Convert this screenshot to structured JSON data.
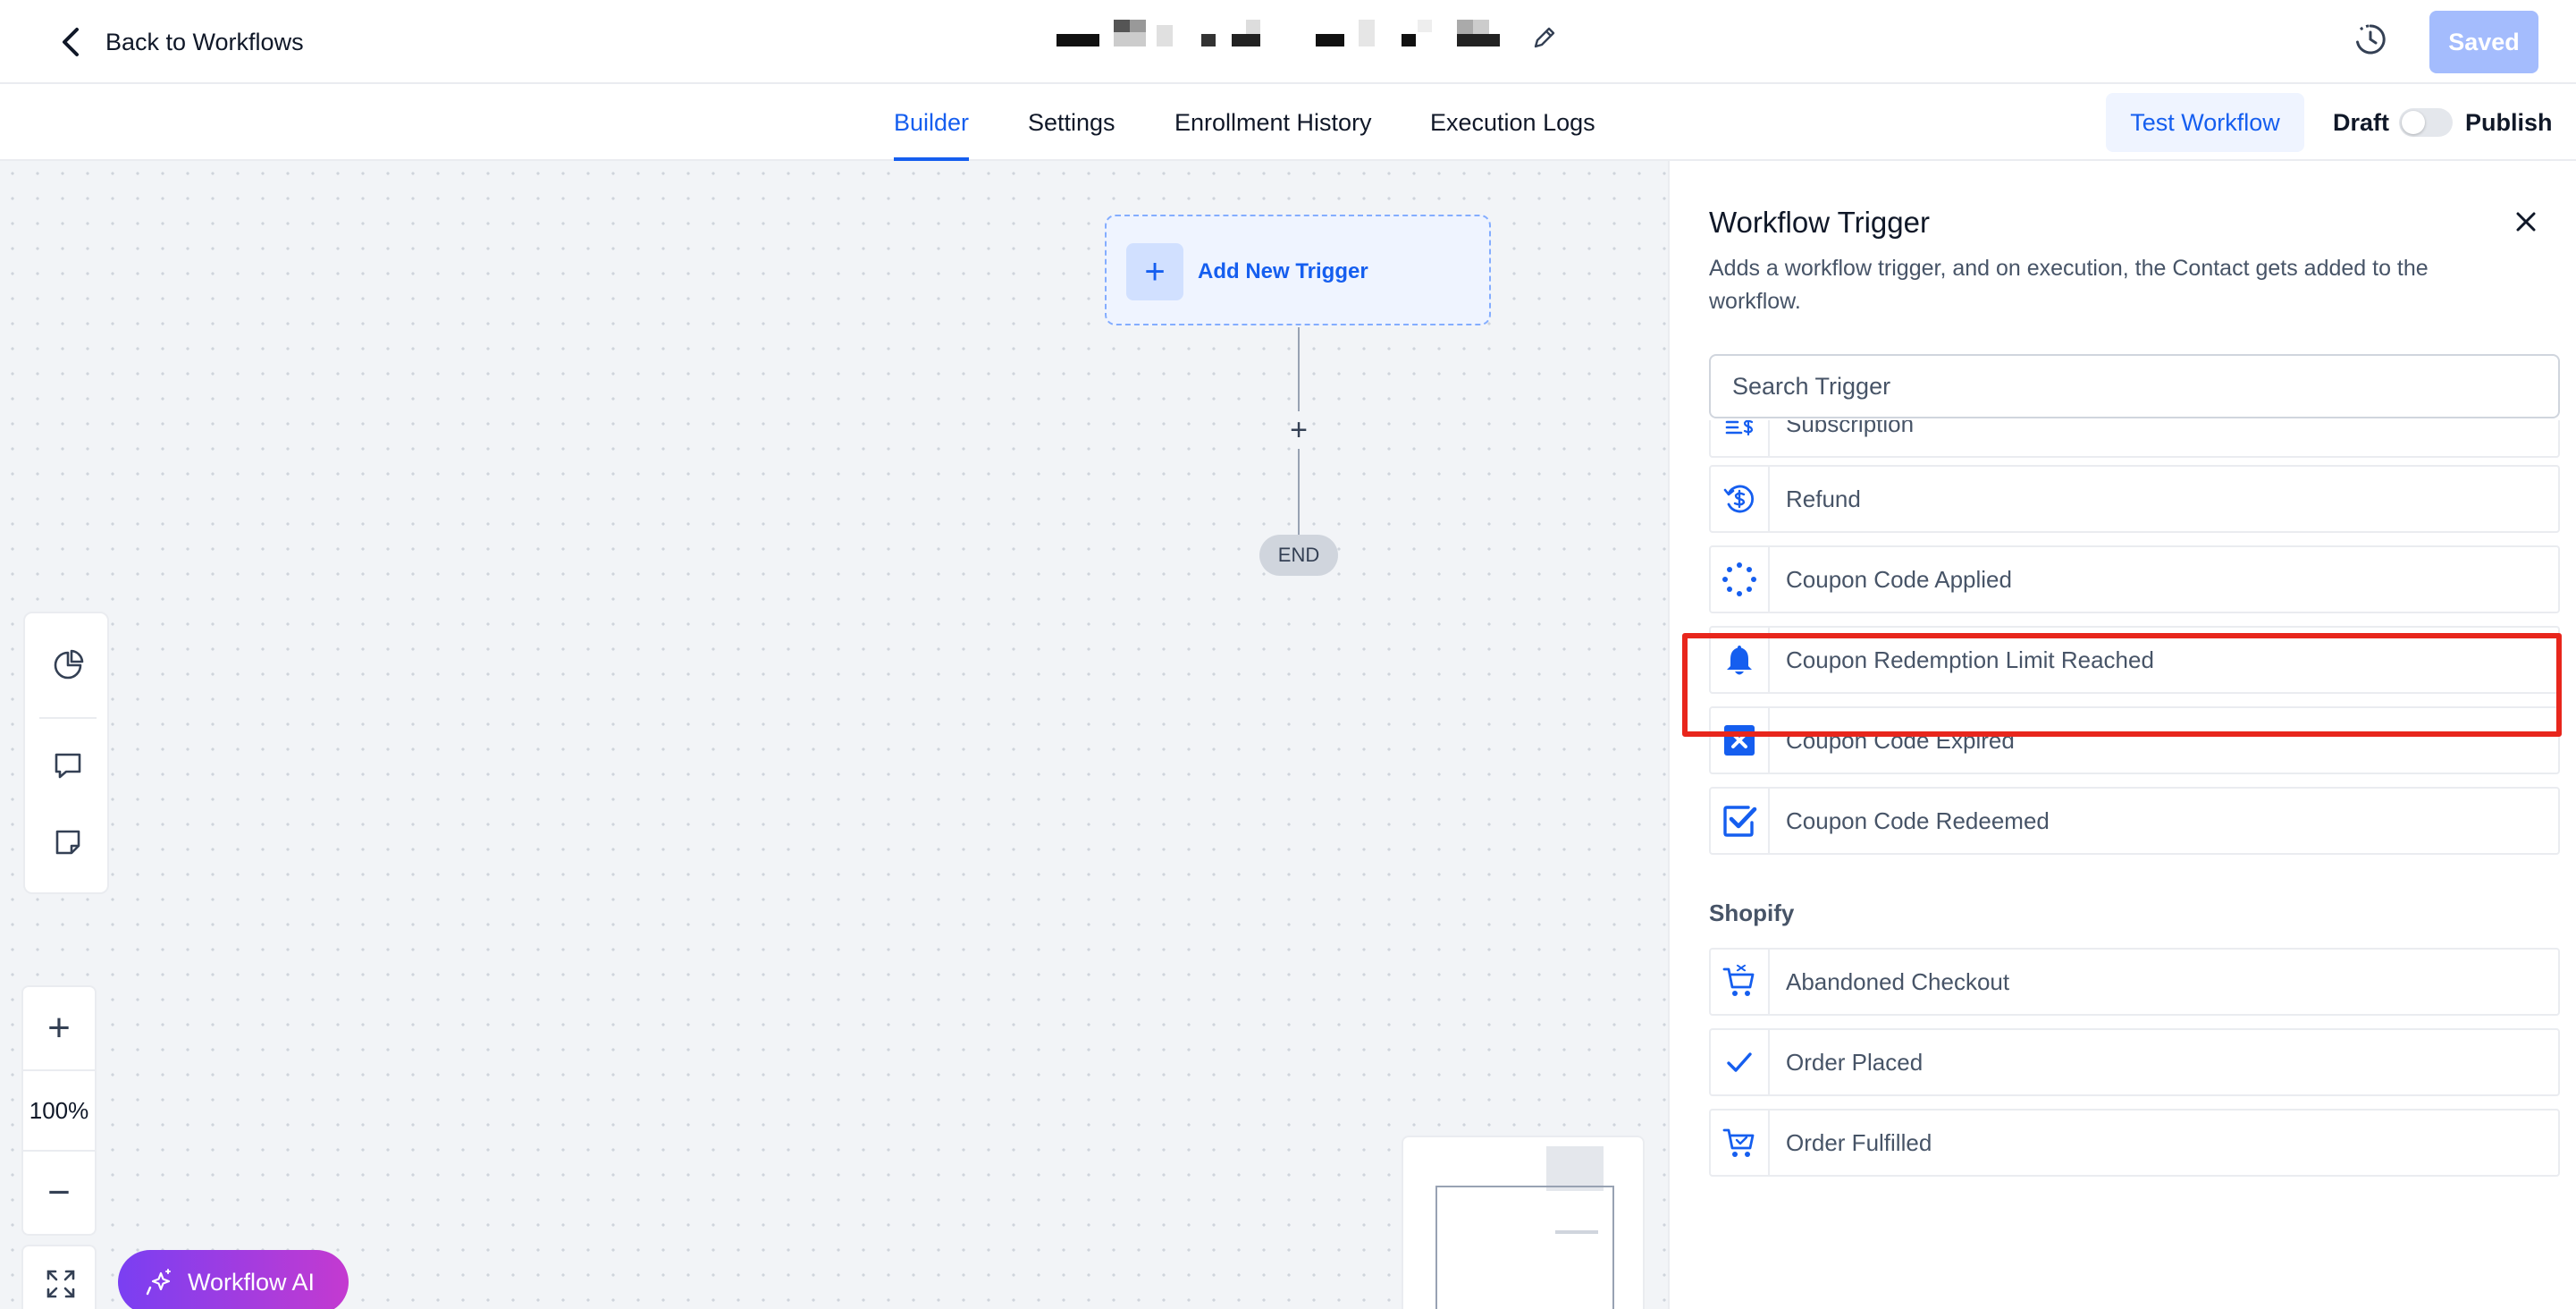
{
  "header": {
    "back_label": "Back to Workflows",
    "saved_label": "Saved"
  },
  "tabs": [
    {
      "label": "Builder",
      "active": true
    },
    {
      "label": "Settings",
      "active": false
    },
    {
      "label": "Enrollment History",
      "active": false
    },
    {
      "label": "Execution Logs",
      "active": false
    }
  ],
  "actions": {
    "test_label": "Test Workflow",
    "draft_label": "Draft",
    "publish_label": "Publish",
    "published": false
  },
  "canvas": {
    "add_trigger_label": "Add New Trigger",
    "add_step_symbol": "+",
    "end_label": "END",
    "zoom": "100%",
    "zoom_in_symbol": "+",
    "zoom_out_symbol": "−",
    "ai_label": "Workflow AI"
  },
  "panel": {
    "title": "Workflow Trigger",
    "description": "Adds a workflow trigger, and on execution, the Contact gets added to the workflow.",
    "search_placeholder": "Search Trigger",
    "items": [
      {
        "label": "Subscription",
        "icon": "subscription-icon"
      },
      {
        "label": "Refund",
        "icon": "refund-icon"
      },
      {
        "label": "Coupon Code Applied",
        "icon": "dotted-circle-icon"
      },
      {
        "label": "Coupon Redemption Limit Reached",
        "icon": "bell-icon",
        "highlighted": true
      },
      {
        "label": "Coupon Code Expired",
        "icon": "x-square-icon"
      },
      {
        "label": "Coupon Code Redeemed",
        "icon": "check-square-icon"
      }
    ],
    "shopify_section": "Shopify",
    "shopify_items": [
      {
        "label": "Abandoned Checkout",
        "icon": "cart-icon"
      },
      {
        "label": "Order Placed",
        "icon": "check-icon"
      },
      {
        "label": "Order Fulfilled",
        "icon": "cart-icon"
      }
    ]
  },
  "colors": {
    "accent": "#155eef",
    "highlight": "#e8261c",
    "saved_button": "#a4bcfd"
  }
}
